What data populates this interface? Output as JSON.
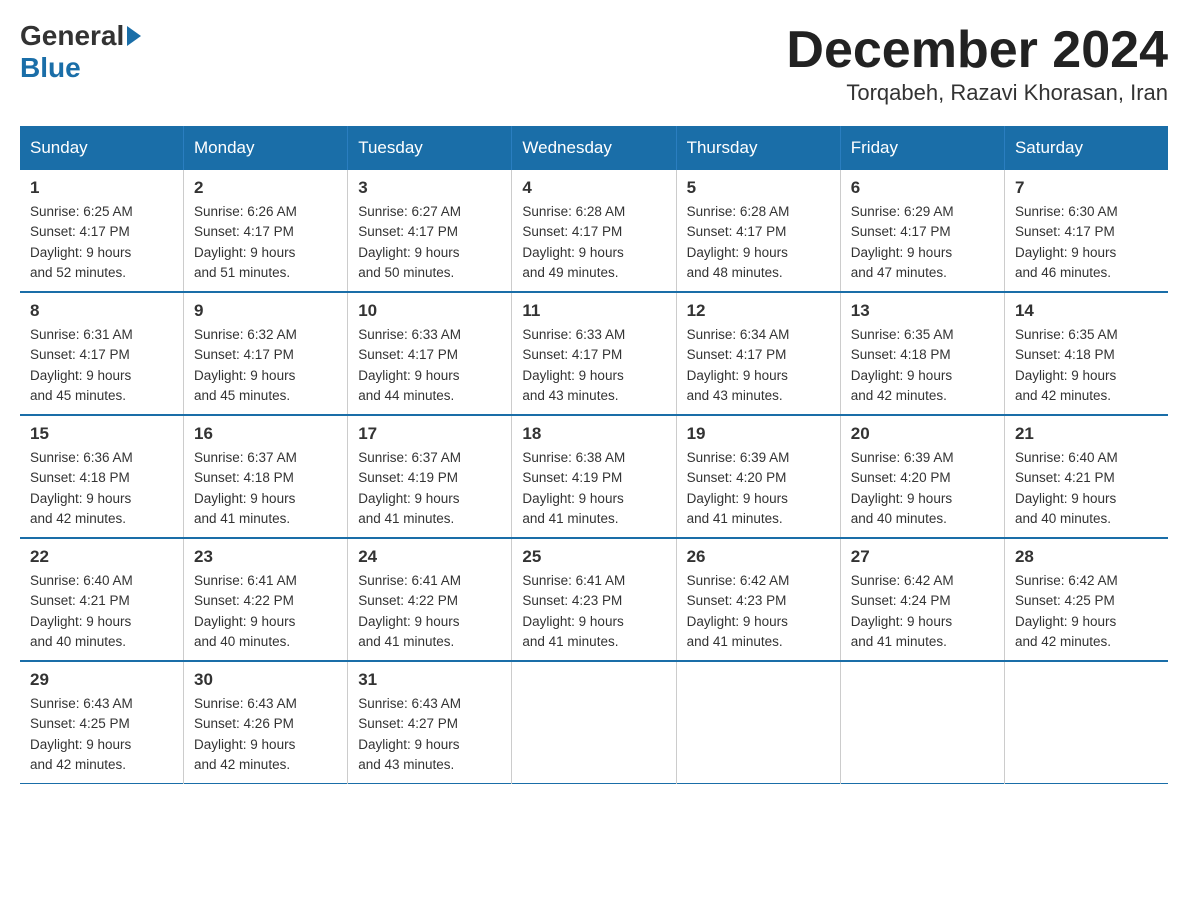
{
  "header": {
    "logo_general": "General",
    "logo_blue": "Blue",
    "title": "December 2024",
    "subtitle": "Torqabeh, Razavi Khorasan, Iran"
  },
  "columns": [
    "Sunday",
    "Monday",
    "Tuesday",
    "Wednesday",
    "Thursday",
    "Friday",
    "Saturday"
  ],
  "weeks": [
    [
      {
        "day": "1",
        "info": "Sunrise: 6:25 AM\nSunset: 4:17 PM\nDaylight: 9 hours\nand 52 minutes."
      },
      {
        "day": "2",
        "info": "Sunrise: 6:26 AM\nSunset: 4:17 PM\nDaylight: 9 hours\nand 51 minutes."
      },
      {
        "day": "3",
        "info": "Sunrise: 6:27 AM\nSunset: 4:17 PM\nDaylight: 9 hours\nand 50 minutes."
      },
      {
        "day": "4",
        "info": "Sunrise: 6:28 AM\nSunset: 4:17 PM\nDaylight: 9 hours\nand 49 minutes."
      },
      {
        "day": "5",
        "info": "Sunrise: 6:28 AM\nSunset: 4:17 PM\nDaylight: 9 hours\nand 48 minutes."
      },
      {
        "day": "6",
        "info": "Sunrise: 6:29 AM\nSunset: 4:17 PM\nDaylight: 9 hours\nand 47 minutes."
      },
      {
        "day": "7",
        "info": "Sunrise: 6:30 AM\nSunset: 4:17 PM\nDaylight: 9 hours\nand 46 minutes."
      }
    ],
    [
      {
        "day": "8",
        "info": "Sunrise: 6:31 AM\nSunset: 4:17 PM\nDaylight: 9 hours\nand 45 minutes."
      },
      {
        "day": "9",
        "info": "Sunrise: 6:32 AM\nSunset: 4:17 PM\nDaylight: 9 hours\nand 45 minutes."
      },
      {
        "day": "10",
        "info": "Sunrise: 6:33 AM\nSunset: 4:17 PM\nDaylight: 9 hours\nand 44 minutes."
      },
      {
        "day": "11",
        "info": "Sunrise: 6:33 AM\nSunset: 4:17 PM\nDaylight: 9 hours\nand 43 minutes."
      },
      {
        "day": "12",
        "info": "Sunrise: 6:34 AM\nSunset: 4:17 PM\nDaylight: 9 hours\nand 43 minutes."
      },
      {
        "day": "13",
        "info": "Sunrise: 6:35 AM\nSunset: 4:18 PM\nDaylight: 9 hours\nand 42 minutes."
      },
      {
        "day": "14",
        "info": "Sunrise: 6:35 AM\nSunset: 4:18 PM\nDaylight: 9 hours\nand 42 minutes."
      }
    ],
    [
      {
        "day": "15",
        "info": "Sunrise: 6:36 AM\nSunset: 4:18 PM\nDaylight: 9 hours\nand 42 minutes."
      },
      {
        "day": "16",
        "info": "Sunrise: 6:37 AM\nSunset: 4:18 PM\nDaylight: 9 hours\nand 41 minutes."
      },
      {
        "day": "17",
        "info": "Sunrise: 6:37 AM\nSunset: 4:19 PM\nDaylight: 9 hours\nand 41 minutes."
      },
      {
        "day": "18",
        "info": "Sunrise: 6:38 AM\nSunset: 4:19 PM\nDaylight: 9 hours\nand 41 minutes."
      },
      {
        "day": "19",
        "info": "Sunrise: 6:39 AM\nSunset: 4:20 PM\nDaylight: 9 hours\nand 41 minutes."
      },
      {
        "day": "20",
        "info": "Sunrise: 6:39 AM\nSunset: 4:20 PM\nDaylight: 9 hours\nand 40 minutes."
      },
      {
        "day": "21",
        "info": "Sunrise: 6:40 AM\nSunset: 4:21 PM\nDaylight: 9 hours\nand 40 minutes."
      }
    ],
    [
      {
        "day": "22",
        "info": "Sunrise: 6:40 AM\nSunset: 4:21 PM\nDaylight: 9 hours\nand 40 minutes."
      },
      {
        "day": "23",
        "info": "Sunrise: 6:41 AM\nSunset: 4:22 PM\nDaylight: 9 hours\nand 40 minutes."
      },
      {
        "day": "24",
        "info": "Sunrise: 6:41 AM\nSunset: 4:22 PM\nDaylight: 9 hours\nand 41 minutes."
      },
      {
        "day": "25",
        "info": "Sunrise: 6:41 AM\nSunset: 4:23 PM\nDaylight: 9 hours\nand 41 minutes."
      },
      {
        "day": "26",
        "info": "Sunrise: 6:42 AM\nSunset: 4:23 PM\nDaylight: 9 hours\nand 41 minutes."
      },
      {
        "day": "27",
        "info": "Sunrise: 6:42 AM\nSunset: 4:24 PM\nDaylight: 9 hours\nand 41 minutes."
      },
      {
        "day": "28",
        "info": "Sunrise: 6:42 AM\nSunset: 4:25 PM\nDaylight: 9 hours\nand 42 minutes."
      }
    ],
    [
      {
        "day": "29",
        "info": "Sunrise: 6:43 AM\nSunset: 4:25 PM\nDaylight: 9 hours\nand 42 minutes."
      },
      {
        "day": "30",
        "info": "Sunrise: 6:43 AM\nSunset: 4:26 PM\nDaylight: 9 hours\nand 42 minutes."
      },
      {
        "day": "31",
        "info": "Sunrise: 6:43 AM\nSunset: 4:27 PM\nDaylight: 9 hours\nand 43 minutes."
      },
      {
        "day": "",
        "info": ""
      },
      {
        "day": "",
        "info": ""
      },
      {
        "day": "",
        "info": ""
      },
      {
        "day": "",
        "info": ""
      }
    ]
  ]
}
